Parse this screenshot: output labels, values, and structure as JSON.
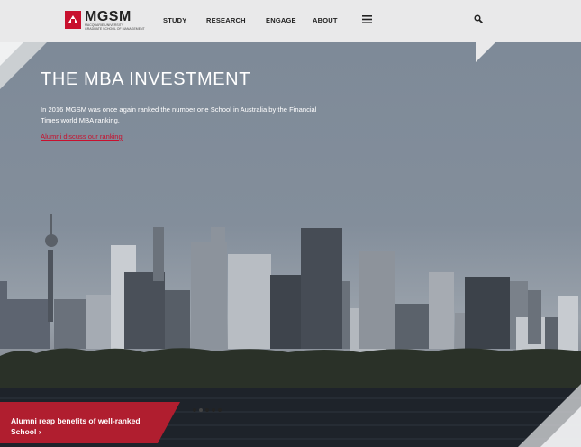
{
  "header": {
    "logo": {
      "name": "MGSM",
      "subtitle": "MACQUARIE UNIVERSITY",
      "subtitle2": "GRADUATE SCHOOL OF MANAGEMENT"
    },
    "nav": [
      {
        "label": "STUDY"
      },
      {
        "label": "RESEARCH"
      },
      {
        "label": "ENGAGE"
      },
      {
        "label": "ABOUT"
      }
    ],
    "menu_icon": "hamburger-icon",
    "search_icon": "search-icon"
  },
  "hero": {
    "title": "THE MBA INVESTMENT",
    "description": "In 2016 MGSM was once again ranked the number one School in Australia by the Financial Times world MBA ranking.",
    "link_text": "Alumni discuss our ranking"
  },
  "banner": {
    "text": "Alumni reap benefits of well-ranked School",
    "arrow": "›"
  },
  "carousel": {
    "count": 5,
    "active": 1
  },
  "colors": {
    "brand_red": "#b01e2f",
    "header_bg": "#e9e9ea",
    "link": "#c8102e"
  }
}
